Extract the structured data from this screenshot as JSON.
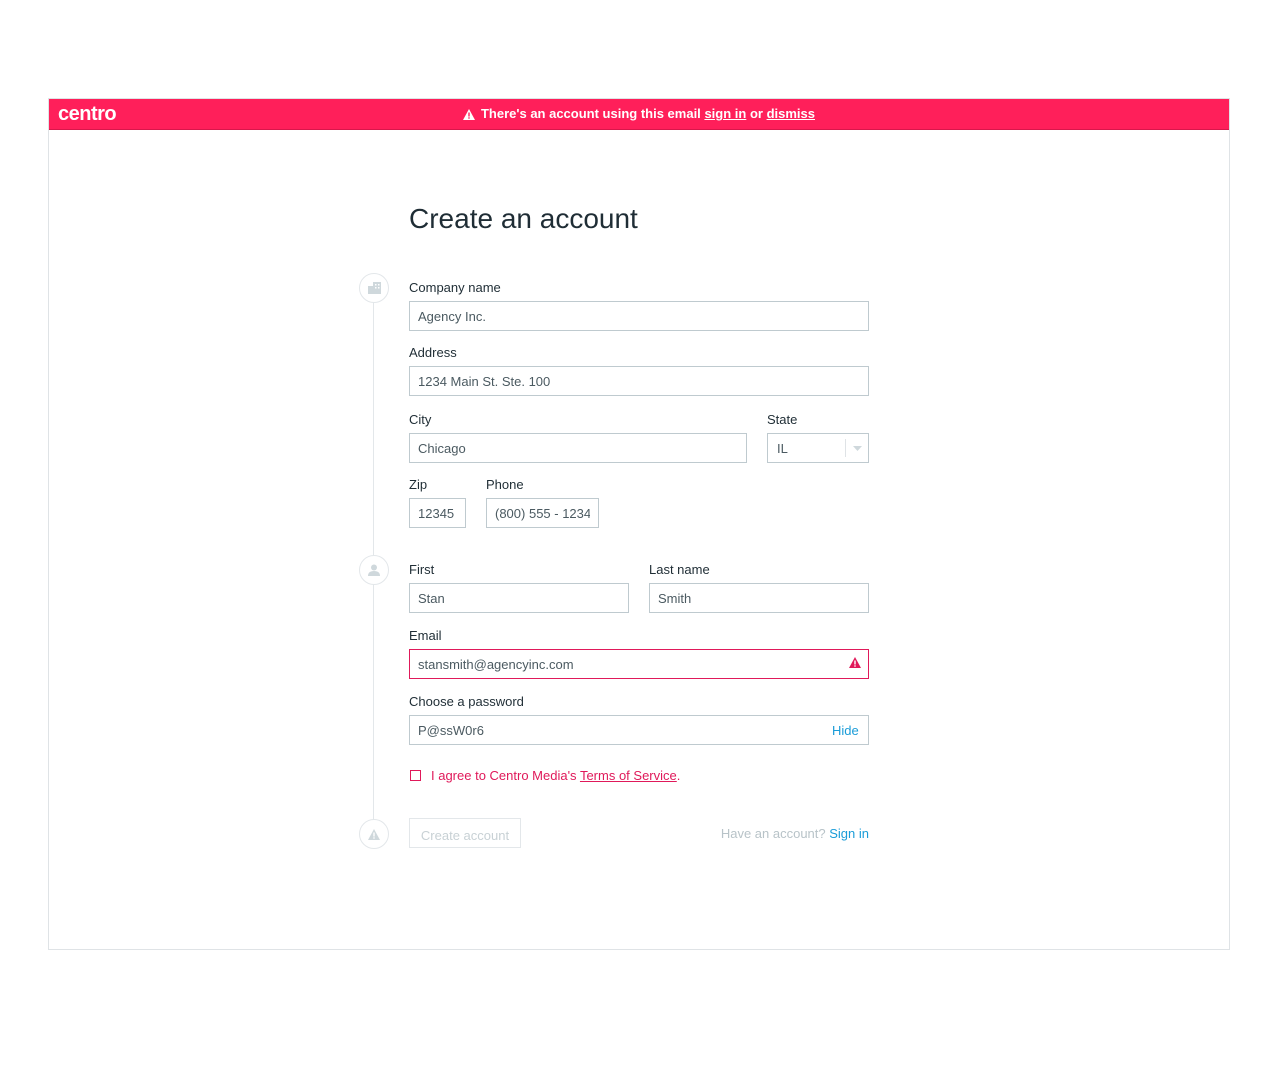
{
  "banner": {
    "logo": "centro",
    "message": "There's an account using this email",
    "sign_in_link": "sign in",
    "or_text": "or",
    "dismiss_link": "dismiss"
  },
  "form": {
    "title": "Create an account",
    "company": {
      "label": "Company name",
      "value": "Agency Inc."
    },
    "address": {
      "label": "Address",
      "value": "1234 Main St. Ste. 100"
    },
    "city": {
      "label": "City",
      "value": "Chicago"
    },
    "state": {
      "label": "State",
      "value": "IL"
    },
    "zip": {
      "label": "Zip",
      "value": "12345"
    },
    "phone": {
      "label": "Phone",
      "value": "(800) 555 - 1234"
    },
    "first": {
      "label": "First",
      "value": "Stan"
    },
    "last": {
      "label": "Last name",
      "value": "Smith"
    },
    "email": {
      "label": "Email",
      "value": "stansmith@agencyinc.com"
    },
    "password": {
      "label": "Choose a password",
      "value": "P@ssW0r6",
      "toggle": "Hide"
    },
    "agree": {
      "text": "I agree to Centro Media's",
      "link": "Terms of Service",
      "end": "."
    },
    "create_button": "Create account",
    "have_account": "Have an account?",
    "sign_in": "Sign in"
  },
  "icons": [
    "building-icon",
    "user-icon",
    "warning-icon",
    "alert-triangle-icon"
  ],
  "colors": {
    "brand": "#ff1f5a",
    "error": "#e0195a",
    "link": "#1a9cd8"
  }
}
